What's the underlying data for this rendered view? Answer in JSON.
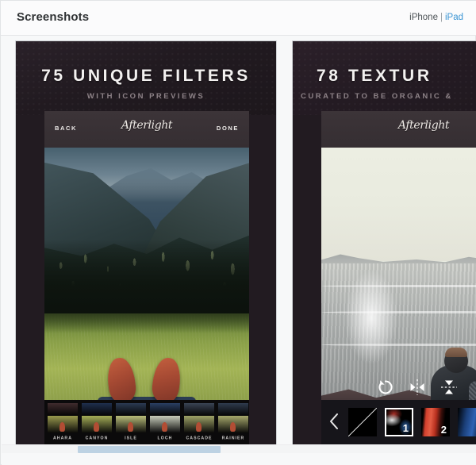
{
  "header": {
    "title": "Screenshots",
    "device_options": [
      {
        "label": "iPhone",
        "state": "active"
      },
      {
        "label": "iPad",
        "state": "link"
      }
    ],
    "separator": "|"
  },
  "colors": {
    "page_bg": "#f7f8f9",
    "card_border": "#e2e4e6",
    "title_text": "#2f3234",
    "link_blue": "#3a95d4",
    "muted_text": "#5b6166",
    "promo_bg": "#221b21",
    "scrollbar_thumb": "#bdd2e3"
  },
  "screenshots": [
    {
      "id": "screenshot-1",
      "promo_title": "75 UNIQUE FILTERS",
      "promo_subtitle": "WITH ICON PREVIEWS",
      "app": {
        "logo": "Afterlight",
        "back_label": "BACK",
        "done_label": "DONE",
        "photo_description": "mountain valley with forested slopes, green grass and red shoes"
      },
      "filters": [
        {
          "name": "AHARA",
          "sky": "#3f2b2d",
          "grass": "#9a9a4e"
        },
        {
          "name": "CANYON",
          "sky": "#1f2f4d",
          "grass": "#a5ae58"
        },
        {
          "name": "ISLE",
          "sky": "#2b3a52",
          "grass": "#b9bd7a"
        },
        {
          "name": "LOCH",
          "sky": "#2a3f63",
          "grass": "#c8cdbb"
        },
        {
          "name": "CASCADE",
          "sky": "#3a4454",
          "grass": "#9fa368"
        },
        {
          "name": "RAINIER",
          "sky": "#2f3b4d",
          "grass": "#a7a96c"
        }
      ]
    },
    {
      "id": "screenshot-2",
      "promo_title": "78 TEXTUR",
      "promo_subtitle": "CURATED TO BE ORGANIC &",
      "app": {
        "logo": "Afterlight",
        "photo_description": "seascape with person in dark jacket sitting on rocks"
      },
      "tools": [
        {
          "name": "rotate-icon",
          "label": "Rotate"
        },
        {
          "name": "flip-horizontal-icon",
          "label": "Flip Horizontal"
        },
        {
          "name": "flip-vertical-icon",
          "label": "Flip Vertical"
        }
      ],
      "texture_nav": {
        "back_chevron": "‹"
      },
      "textures": [
        {
          "label": "",
          "type": "none",
          "selected": false
        },
        {
          "label": "1",
          "type": "light",
          "selected": true
        },
        {
          "label": "2",
          "type": "red",
          "selected": false
        },
        {
          "label": "",
          "type": "blue",
          "selected": false
        }
      ]
    }
  ],
  "scrollbar": {
    "orientation": "horizontal",
    "position_percent": 23
  }
}
